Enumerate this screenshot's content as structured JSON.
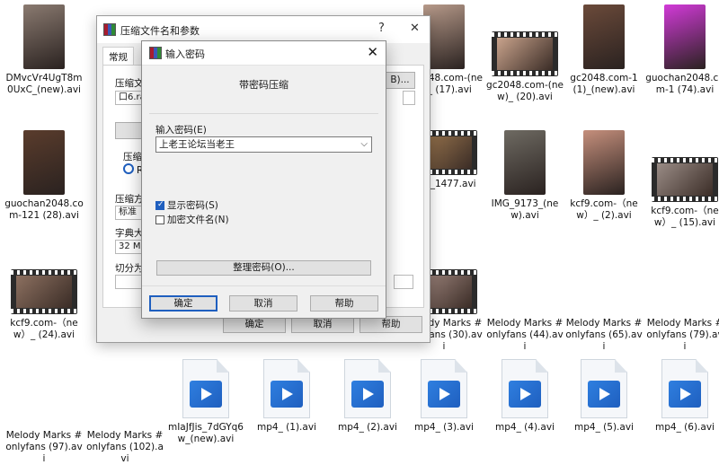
{
  "files": [
    {
      "name": "DMvcVr4UgT8m0UxC_(new).avi",
      "kind": "photo",
      "color": "#8a7a70"
    },
    {
      "name": "gc2048.com-(new)_ (17).avi",
      "kind": "photo",
      "color": "#b79a8a"
    },
    {
      "name": "gc2048.com-(new)_ (20).avi",
      "kind": "video",
      "color": "#c9a38c"
    },
    {
      "name": "gc2048.com-1 (1)_(new).avi",
      "kind": "photo",
      "color": "#6b4a3a"
    },
    {
      "name": "guochan2048.com-1 (74).avi",
      "kind": "photo",
      "color": "#d23ad8"
    },
    {
      "name": "guochan2048.com-121 (28).avi",
      "kind": "photo",
      "color": "#5a3c2c"
    },
    {
      "name": "IMG_1477.avi",
      "kind": "video",
      "color": "#a07a50"
    },
    {
      "name": "IMG_9173_(new).avi",
      "kind": "photo",
      "color": "#6e6a62"
    },
    {
      "name": "kcf9.com-（new）_ (2).avi",
      "kind": "photo",
      "color": "#c58f7c"
    },
    {
      "name": "kcf9.com-（new）_ (15).avi",
      "kind": "video",
      "color": "#9a8c86"
    },
    {
      "name": "kcf9.com-（new）_ (24).avi",
      "kind": "video",
      "color": "#8c7060"
    },
    {
      "name": "Melody Marks #onlyfans (30).avi",
      "kind": "video",
      "color": "#a48a82"
    },
    {
      "name": "Melody Marks #onlyfans (44).avi",
      "kind": "none",
      "color": ""
    },
    {
      "name": "Melody Marks #onlyfans (65).avi",
      "kind": "none",
      "color": ""
    },
    {
      "name": "Melody Marks #onlyfans (79).avi",
      "kind": "none",
      "color": ""
    },
    {
      "name": "Melody Marks #onlyfans (97).avi",
      "kind": "none",
      "color": ""
    },
    {
      "name": "Melody Marks #onlyfans (102).avi",
      "kind": "none",
      "color": ""
    },
    {
      "name": "mIaJfJis_7dGYq6w_(new).avi",
      "kind": "mp4",
      "color": ""
    },
    {
      "name": "mp4_ (1).avi",
      "kind": "mp4",
      "color": ""
    },
    {
      "name": "mp4_ (2).avi",
      "kind": "mp4",
      "color": ""
    },
    {
      "name": "mp4_ (3).avi",
      "kind": "mp4",
      "color": ""
    },
    {
      "name": "mp4_ (4).avi",
      "kind": "mp4",
      "color": ""
    },
    {
      "name": "mp4_ (5).avi",
      "kind": "mp4",
      "color": ""
    },
    {
      "name": "mp4_ (6).avi",
      "kind": "mp4",
      "color": ""
    }
  ],
  "bg_dialog": {
    "title": "压缩文件名和参数",
    "help_btn": "?",
    "close_btn": "✕",
    "tab_general": "常规",
    "label_archive": "压缩文",
    "field_archive": "口6.ra",
    "browse": "B)...",
    "label_format": "压缩",
    "radio_rar": "RA",
    "label_method": "压缩方",
    "field_method": "标准",
    "label_dict": "字典大",
    "field_dict": "32 MB",
    "label_split": "切分为",
    "ok": "确定",
    "cancel": "取消",
    "help": "帮助"
  },
  "pw_dialog": {
    "title": "输入密码",
    "close": "✕",
    "heading": "带密码压缩",
    "enter_label": "输入密码(E)",
    "password_value": "上老王论坛当老王",
    "show_password": "显示密码(S)",
    "show_password_checked": true,
    "encrypt_names": "加密文件名(N)",
    "encrypt_names_checked": false,
    "organize": "整理密码(O)...",
    "ok": "确定",
    "cancel": "取消",
    "help": "帮助"
  }
}
